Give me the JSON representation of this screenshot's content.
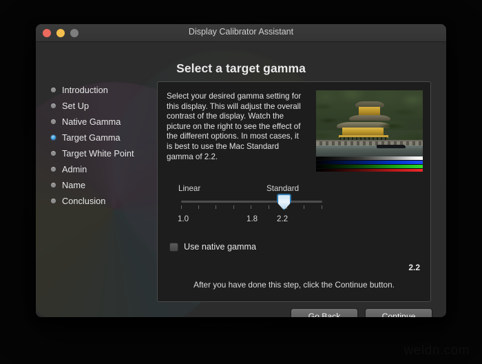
{
  "desktop": {
    "watermark": "weldn.com"
  },
  "window": {
    "title": "Display Calibrator Assistant",
    "traffic_lights": {
      "close": "close-button",
      "minimize": "minimize-button",
      "zoom": "zoom-button"
    },
    "page_title": "Select a target gamma"
  },
  "sidebar": {
    "items": [
      {
        "label": "Introduction",
        "current": false
      },
      {
        "label": "Set Up",
        "current": false
      },
      {
        "label": "Native Gamma",
        "current": false
      },
      {
        "label": "Target Gamma",
        "current": true
      },
      {
        "label": "Target White Point",
        "current": false
      },
      {
        "label": "Admin",
        "current": false
      },
      {
        "label": "Name",
        "current": false
      },
      {
        "label": "Conclusion",
        "current": false
      }
    ]
  },
  "panel": {
    "description": "Select your desired gamma setting for this display. This will adjust the overall contrast of the display. Watch the picture on the right to see the effect of the different options. In most cases, it is best to use the Mac Standard gamma of 2.2.",
    "preview": {
      "alt": "Golden pavilion temple beside a pond with pine trees",
      "color_bars": [
        "gray-ramp",
        "blue-ramp",
        "green-ramp",
        "red-ramp"
      ]
    },
    "slider": {
      "left_label": "Linear",
      "right_label": "Standard",
      "tick_labels": [
        "1.0",
        "1.8",
        "2.2"
      ],
      "tick_count": 9,
      "min": 1.0,
      "max": 2.6,
      "value": 2.2
    },
    "checkbox": {
      "label": "Use native gamma",
      "checked": false
    },
    "gamma_value": "2.2",
    "hint": "After you have done this step, click the Continue button."
  },
  "footer": {
    "go_back_label": "Go Back",
    "continue_label": "Continue"
  },
  "colors": {
    "accent": "#3c9fe0",
    "window_bg": "#2c2c2c",
    "panel_bg": "#1d1d1d",
    "titlebar": "#363636",
    "close": "#ed6a5e",
    "minimize": "#f5bf4f",
    "zoom": "#7e7e7e"
  }
}
